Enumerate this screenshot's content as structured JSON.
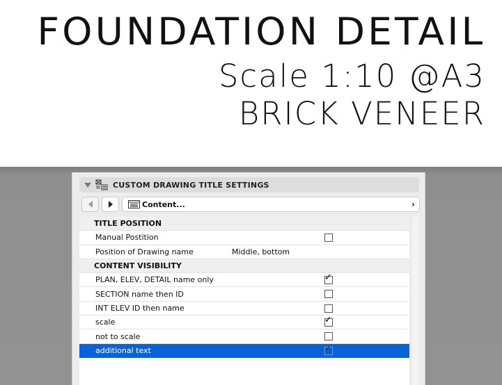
{
  "title": {
    "line1": "FOUNDATION DETAIL",
    "line2": "Scale 1:10 @A3",
    "line3": "BRICK VENEER"
  },
  "panel": {
    "header_label": "CUSTOM DRAWING TITLE SETTINGS",
    "header_icon": "drawing-title-icon",
    "content_label": "Content...",
    "content_icon": "content-list-icon",
    "accent_color": "#0a63d6"
  },
  "rows": [
    {
      "type": "section",
      "label": "TITLE POSITION"
    },
    {
      "type": "check",
      "label": "Manual Postition",
      "checked": false
    },
    {
      "type": "value",
      "label": "Position of Drawing name",
      "value": "Middle, bottom"
    },
    {
      "type": "section",
      "label": "CONTENT VISIBILITY"
    },
    {
      "type": "check",
      "label": "PLAN, ELEV, DETAIL name only",
      "checked": true
    },
    {
      "type": "check",
      "label": "SECTION name then ID",
      "checked": false
    },
    {
      "type": "check",
      "label": "INT ELEV ID then name",
      "checked": false
    },
    {
      "type": "check",
      "label": "scale",
      "checked": true
    },
    {
      "type": "check",
      "label": "not to scale",
      "checked": false
    },
    {
      "type": "check",
      "label": "additional text",
      "checked": true,
      "selected": true
    }
  ]
}
